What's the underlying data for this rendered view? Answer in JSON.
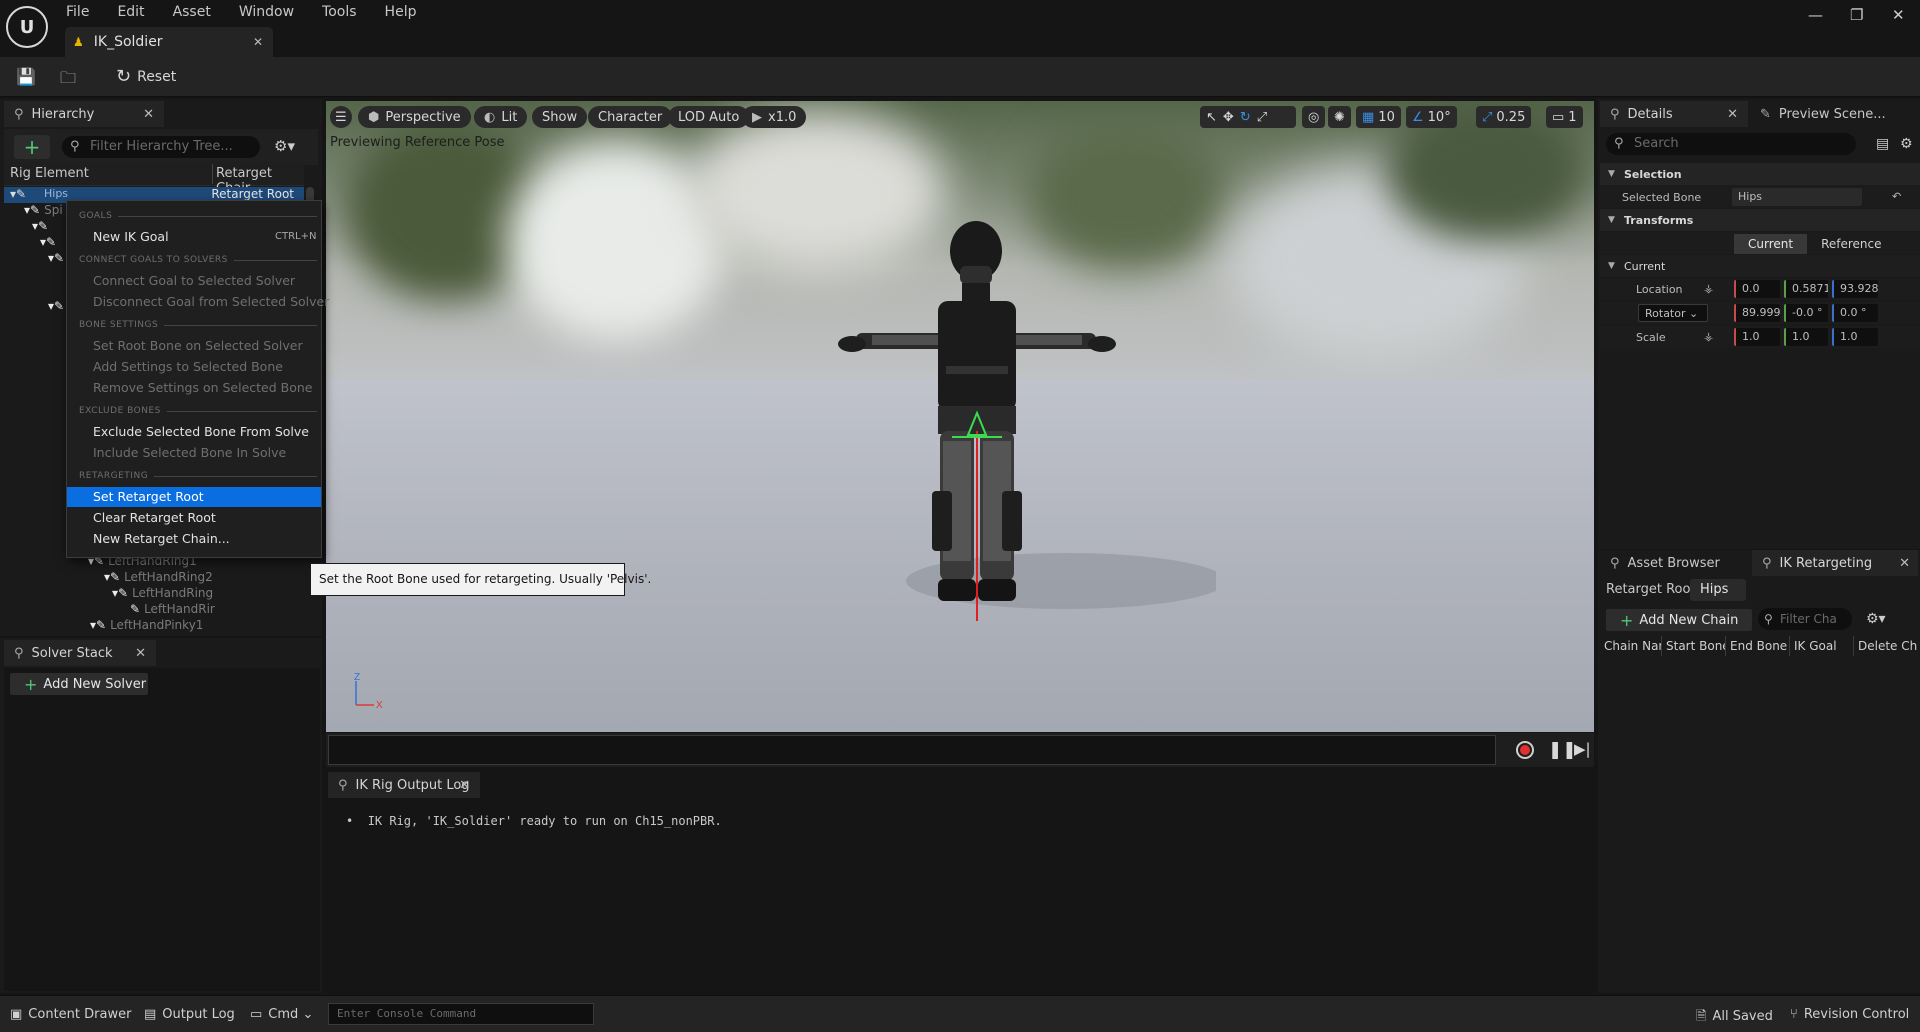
{
  "menu": [
    "File",
    "Edit",
    "Asset",
    "Window",
    "Tools",
    "Help"
  ],
  "doc_tab": {
    "title": "IK_Soldier"
  },
  "toolbar": {
    "reset_label": "Reset"
  },
  "hierarchy": {
    "tab_label": "Hierarchy",
    "search_placeholder": "Filter Hierarchy Tree...",
    "col_rig_element": "Rig Element",
    "col_retarget_chain": "Retarget Chair",
    "hips_name": "Hips",
    "hips_chain": "Retarget Root",
    "rows": [
      "Spi",
      "LeftHandRing1",
      "LeftHandRing2",
      "LeftHandRing",
      "LeftHandRir",
      "LeftHandPinky1"
    ]
  },
  "solver_stack": {
    "tab_label": "Solver Stack",
    "add_label": "Add New Solver"
  },
  "viewport": {
    "perspective": "Perspective",
    "lit": "Lit",
    "show": "Show",
    "character": "Character",
    "lod": "LOD Auto",
    "speed": "x1.0",
    "grid_snap": "10",
    "rot_snap": "10°",
    "scale_snap": "0.25",
    "camera_speed": "1",
    "preview_label": "Previewing Reference Pose",
    "axis_z": "Z",
    "axis_x": "X"
  },
  "output_log": {
    "tab_label": "IK Rig Output Log",
    "message": "IK Rig, 'IK_Soldier' ready to run on Ch15_nonPBR."
  },
  "details": {
    "tab_label": "Details",
    "preview_tab_label": "Preview Scene...",
    "search_placeholder": "Search",
    "selection_header": "Selection",
    "selected_bone_label": "Selected Bone",
    "selected_bone_value": "Hips",
    "transforms_header": "Transforms",
    "current_btn": "Current",
    "reference_btn": "Reference",
    "current_header": "Current",
    "location_label": "Location",
    "location": [
      "0.0",
      "0.5871",
      "93.928"
    ],
    "rotator_label": "Rotator",
    "rotation": [
      "89.999",
      "-0.0 °",
      "0.0 °"
    ],
    "scale_label": "Scale",
    "scale": [
      "1.0",
      "1.0",
      "1.0"
    ]
  },
  "ik_retargeting": {
    "asset_browser_tab": "Asset Browser",
    "tab_label": "IK Retargeting",
    "retarget_root_label": "Retarget Root:",
    "retarget_root_value": "Hips",
    "add_chain_label": "Add New Chain",
    "filter_placeholder": "Filter Cha",
    "columns": [
      "Chain Nar",
      "Start Bone",
      "End Bone",
      "IK Goal",
      "Delete Ch"
    ]
  },
  "context_menu": {
    "sections": {
      "goals": "GOALS",
      "connect": "CONNECT GOALS TO SOLVERS",
      "bone_settings": "BONE SETTINGS",
      "exclude": "EXCLUDE BONES",
      "retargeting": "RETARGETING"
    },
    "items": {
      "new_ik_goal": "New IK Goal",
      "new_ik_goal_shortcut": "CTRL+N",
      "connect_goal": "Connect Goal to Selected Solver",
      "disconnect_goal": "Disconnect Goal from Selected Solver",
      "set_root_bone": "Set Root Bone on Selected Solver",
      "add_settings": "Add Settings to Selected Bone",
      "remove_settings": "Remove Settings on Selected Bone",
      "exclude_bone": "Exclude Selected Bone From Solve",
      "include_bone": "Include Selected Bone In Solve",
      "set_retarget_root": "Set Retarget Root",
      "clear_retarget_root": "Clear Retarget Root",
      "new_retarget_chain": "New Retarget Chain..."
    },
    "tooltip": "Set the Root Bone used for retargeting. Usually 'Pelvis'."
  },
  "statusbar": {
    "content_drawer": "Content Drawer",
    "output_log": "Output Log",
    "cmd": "Cmd",
    "console_placeholder": "Enter Console Command",
    "all_saved": "All Saved",
    "revision_control": "Revision Control"
  },
  "colors": {
    "accent": "#0a6ee0",
    "selection": "#1e4a7a",
    "add_green": "#50c878"
  }
}
